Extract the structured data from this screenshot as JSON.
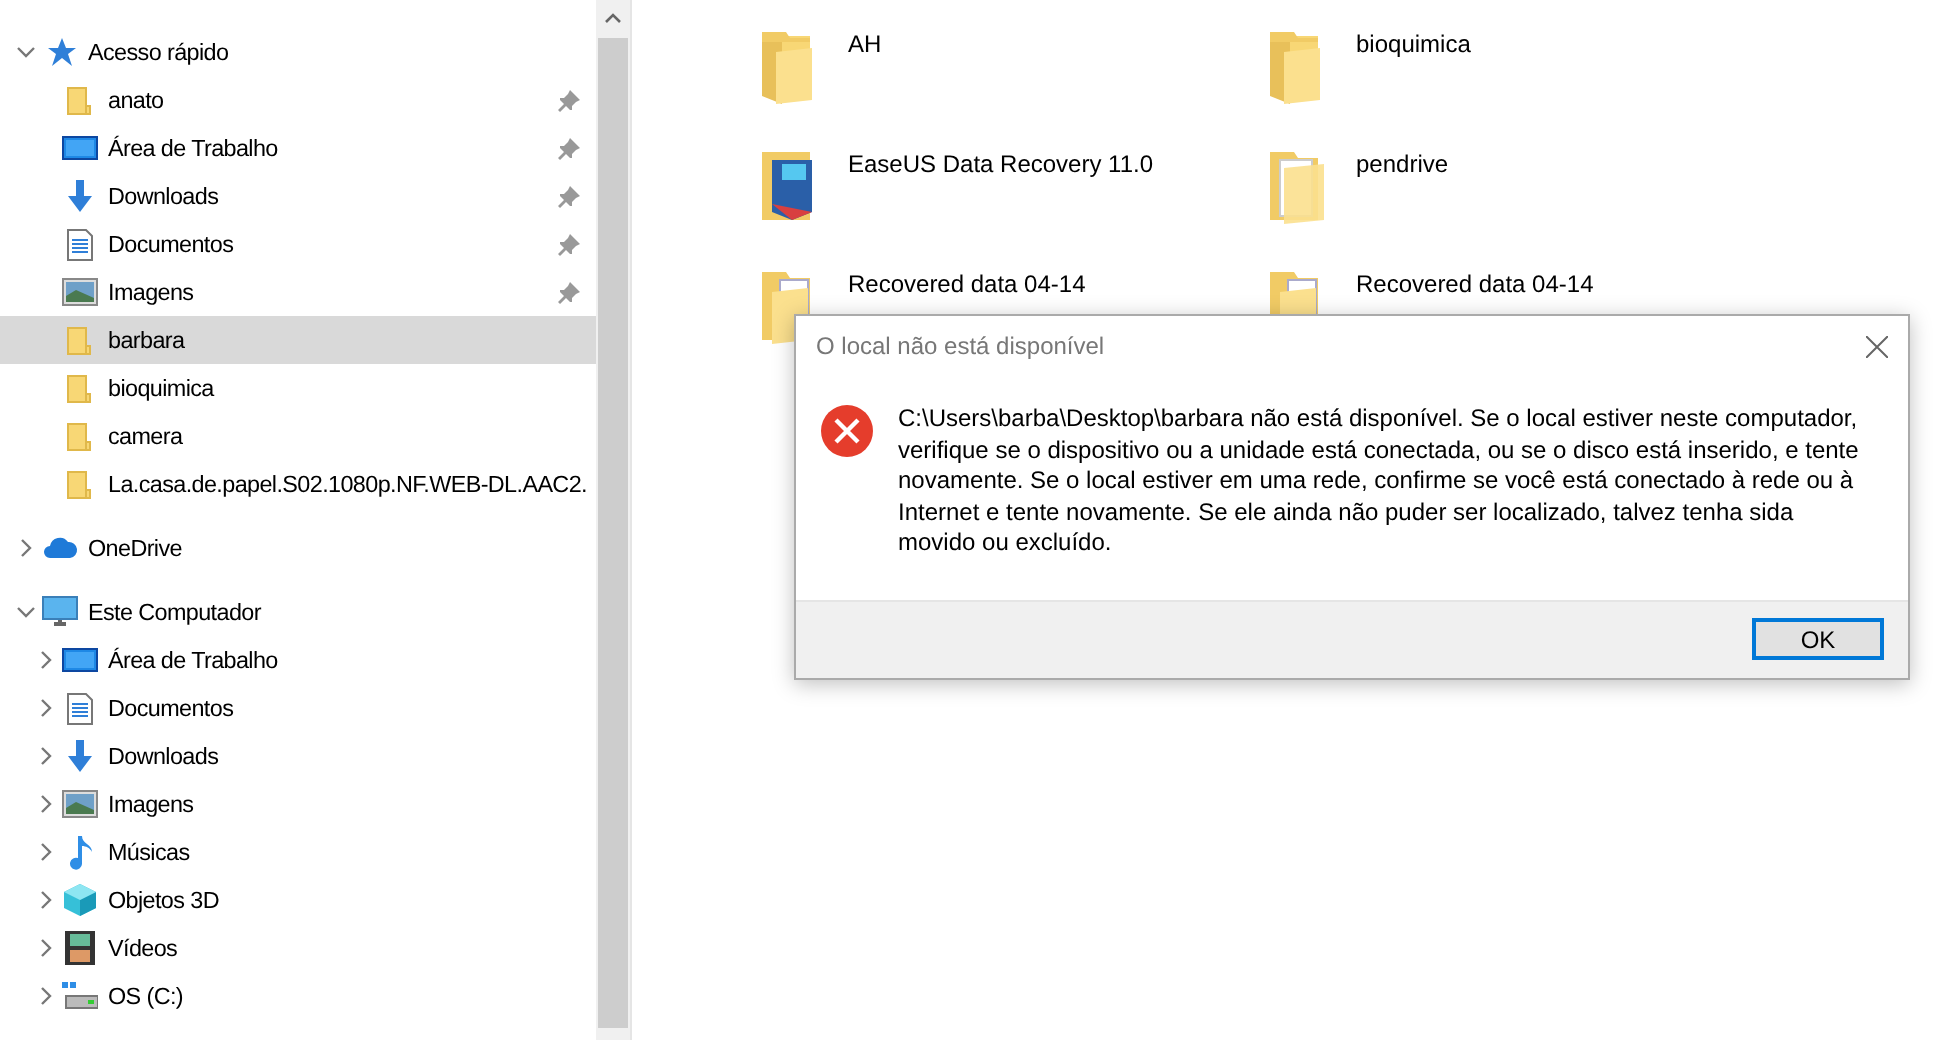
{
  "navigation": {
    "sections": [
      {
        "label": "Acesso rápido",
        "kind": "star",
        "expanded": true,
        "children": [
          {
            "label": "anato",
            "kind": "folder",
            "pinned": true,
            "selected": false
          },
          {
            "label": "Área de Trabalho",
            "kind": "desktop",
            "pinned": true,
            "selected": false
          },
          {
            "label": "Downloads",
            "kind": "downloads",
            "pinned": true,
            "selected": false
          },
          {
            "label": "Documentos",
            "kind": "documents",
            "pinned": true,
            "selected": false
          },
          {
            "label": "Imagens",
            "kind": "pictures",
            "pinned": true,
            "selected": false
          },
          {
            "label": "barbara",
            "kind": "folder",
            "pinned": false,
            "selected": true
          },
          {
            "label": "bioquimica",
            "kind": "folder",
            "pinned": false,
            "selected": false
          },
          {
            "label": "camera",
            "kind": "folder",
            "pinned": false,
            "selected": false
          },
          {
            "label": "La.casa.de.papel.S02.1080p.NF.WEB-DL.AAC2.",
            "kind": "folder",
            "pinned": false,
            "selected": false
          }
        ]
      },
      {
        "label": "OneDrive",
        "kind": "cloud",
        "expanded": false
      },
      {
        "label": "Este Computador",
        "kind": "computer",
        "expanded": true,
        "children": [
          {
            "label": "Área de Trabalho",
            "kind": "desktop",
            "expanded": false,
            "selected": false
          },
          {
            "label": "Documentos",
            "kind": "documents",
            "expanded": false,
            "selected": false
          },
          {
            "label": "Downloads",
            "kind": "downloads",
            "expanded": false,
            "selected": false
          },
          {
            "label": "Imagens",
            "kind": "pictures",
            "expanded": false,
            "selected": false
          },
          {
            "label": "Músicas",
            "kind": "music",
            "expanded": false,
            "selected": false
          },
          {
            "label": "Objetos 3D",
            "kind": "cube",
            "expanded": false,
            "selected": false
          },
          {
            "label": "Vídeos",
            "kind": "videos",
            "expanded": false,
            "selected": false
          },
          {
            "label": "OS (C:)",
            "kind": "drive",
            "expanded": false,
            "selected": false
          }
        ]
      }
    ]
  },
  "files": [
    {
      "name": "AH",
      "kind": "folder"
    },
    {
      "name": "bioquimica",
      "kind": "folder"
    },
    {
      "name": "EaseUS Data Recovery 11.0",
      "kind": "app-folder"
    },
    {
      "name": "pendrive",
      "kind": "paper-folder"
    },
    {
      "name": "Recovered data 04-14",
      "kind": "file-folder"
    },
    {
      "name": "Recovered data 04-14",
      "kind": "file-folder"
    }
  ],
  "dialog": {
    "title": "O local não está disponível",
    "kind": "error",
    "message": "C:\\Users\\barba\\Desktop\\barbara não está disponível. Se o local estiver neste computador, verifique se o dispositivo ou a unidade está conectada, ou se o disco está inserido, e tente novamente. Se o local estiver em uma rede, confirme se você está conectado à rede ou à Internet e tente novamente. Se ele ainda não puder ser localizado, talvez tenha sida movido ou excluído.",
    "buttons": [
      "OK"
    ]
  }
}
